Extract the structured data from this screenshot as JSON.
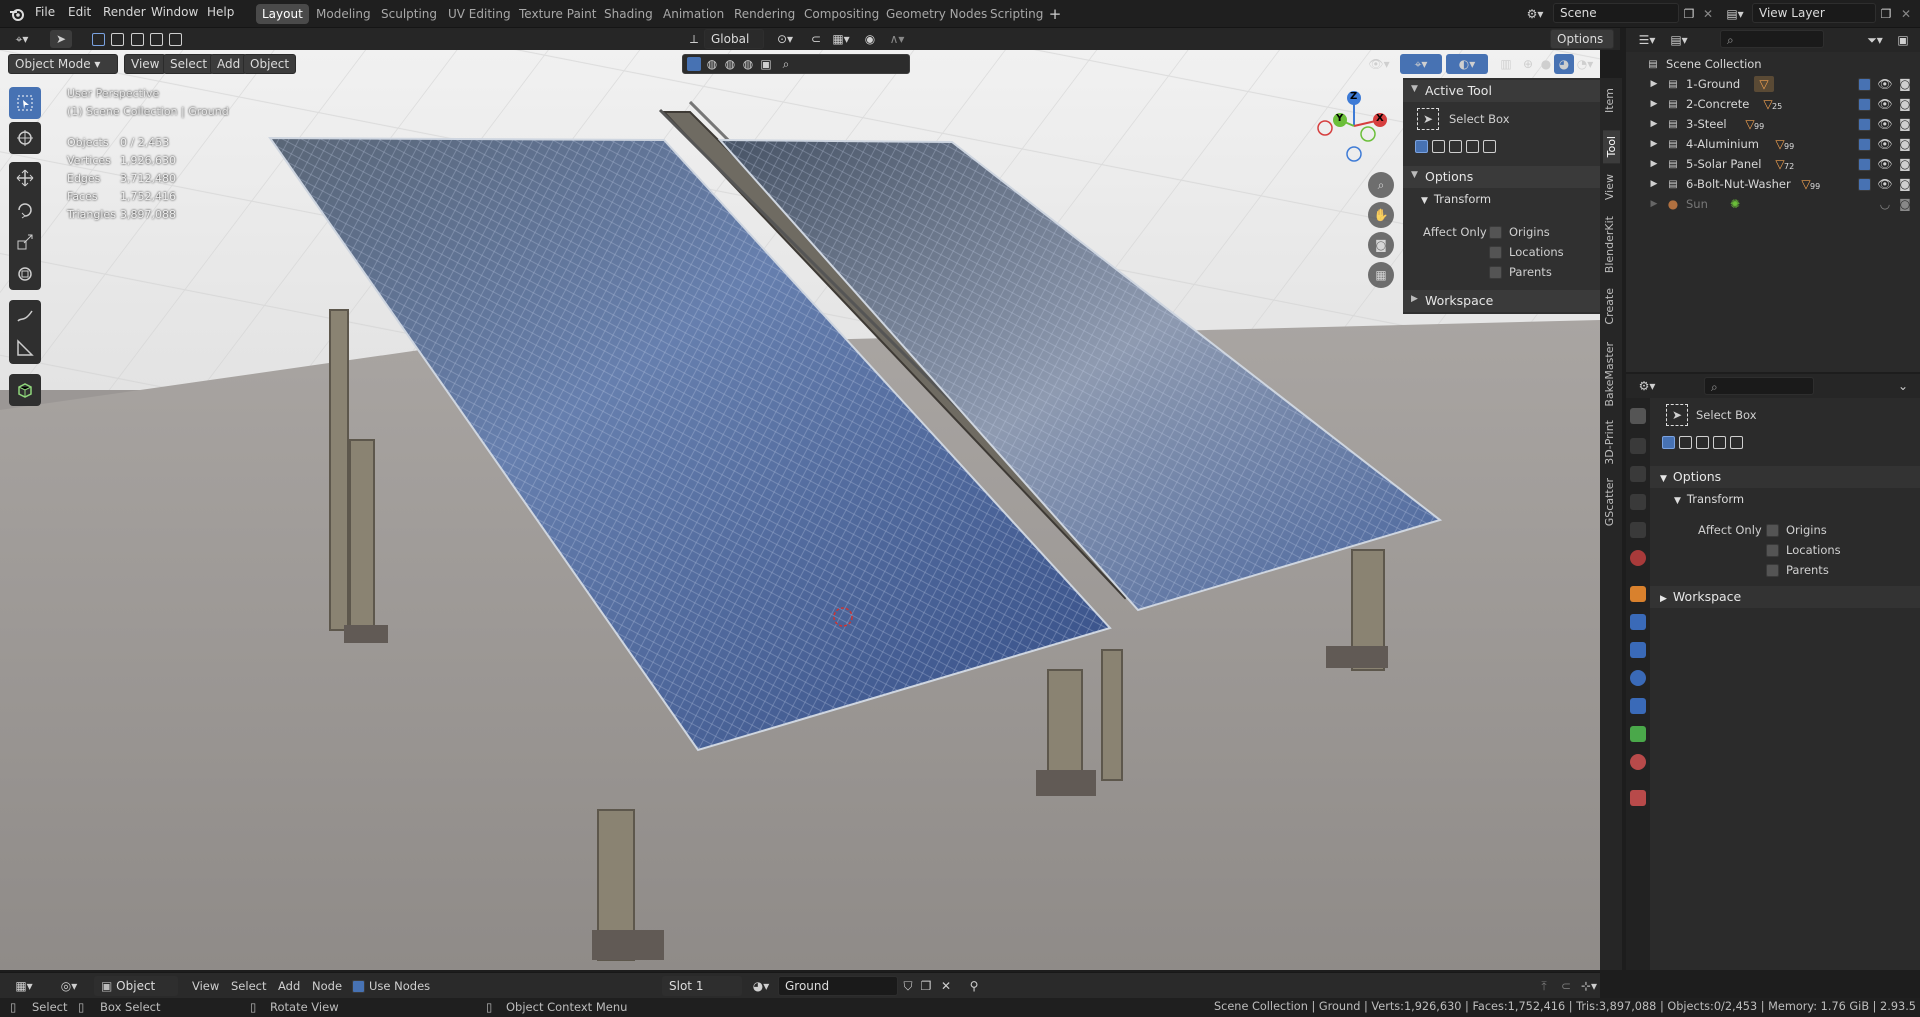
{
  "menus": [
    "File",
    "Edit",
    "Render",
    "Window",
    "Help"
  ],
  "workspace_tabs": [
    "Layout",
    "Modeling",
    "Sculpting",
    "UV Editing",
    "Texture Paint",
    "Shading",
    "Animation",
    "Rendering",
    "Compositing",
    "Geometry Nodes",
    "Scripting"
  ],
  "scene": {
    "name": "Scene",
    "view_layer": "View Layer"
  },
  "tool_header": {
    "orientation": "Global",
    "options": "Options"
  },
  "viewport_header": {
    "mode": "Object Mode",
    "view": "View",
    "select": "Select",
    "add": "Add",
    "object": "Object"
  },
  "viewport_overlay": {
    "perspective": "User Perspective",
    "collection": "(1) Scene Collection | Ground",
    "stats": [
      {
        "label": "Objects",
        "value": "0 / 2,453"
      },
      {
        "label": "Vertices",
        "value": "1,926,630"
      },
      {
        "label": "Edges",
        "value": "3,712,480"
      },
      {
        "label": "Faces",
        "value": "1,752,416"
      },
      {
        "label": "Triangles",
        "value": "3,897,088"
      }
    ]
  },
  "gizmo": {
    "x": "X",
    "y": "Y",
    "z": "Z"
  },
  "n_panel": {
    "active_tool": "Active Tool",
    "tool_name": "Select Box",
    "options": "Options",
    "transform": "Transform",
    "affect_only": "Affect Only",
    "origins": "Origins",
    "locations": "Locations",
    "parents": "Parents",
    "workspace": "Workspace"
  },
  "sidebar_tabs": [
    "Item",
    "Tool",
    "View",
    "BlenderKit",
    "Create",
    "BakeMaster",
    "3D-Print",
    "GScatter"
  ],
  "outliner": {
    "root": "Scene Collection",
    "items": [
      {
        "name": "1-Ground",
        "badge": ""
      },
      {
        "name": "2-Concrete",
        "badge": "25"
      },
      {
        "name": "3-Steel",
        "badge": "99"
      },
      {
        "name": "4-Aluminium",
        "badge": "99"
      },
      {
        "name": "5-Solar Panel",
        "badge": "72"
      },
      {
        "name": "6-Bolt-Nut-Washer",
        "badge": "99"
      },
      {
        "name": "Sun",
        "badge": ""
      }
    ]
  },
  "properties": {
    "tool_name": "Select Box",
    "options": "Options",
    "transform": "Transform",
    "affect_only": "Affect Only",
    "origins": "Origins",
    "locations": "Locations",
    "parents": "Parents",
    "workspace": "Workspace"
  },
  "timeline": {
    "editor": "Object",
    "view": "View",
    "select": "Select",
    "add": "Add",
    "node": "Node",
    "use_nodes": "Use Nodes",
    "slot": "Slot 1",
    "material": "Ground"
  },
  "status": {
    "select": "Select",
    "box_select": "Box Select",
    "rotate": "Rotate View",
    "context": "Object Context Menu",
    "info": "Scene Collection | Ground | Verts:1,926,630 | Faces:1,752,416 | Tris:3,897,088 | Objects:0/2,453 | Memory: 1.76 GiB | 2.93.5"
  },
  "colors": {
    "accent": "#4772b3",
    "ground": "#9b9795",
    "panel": "#303030"
  }
}
